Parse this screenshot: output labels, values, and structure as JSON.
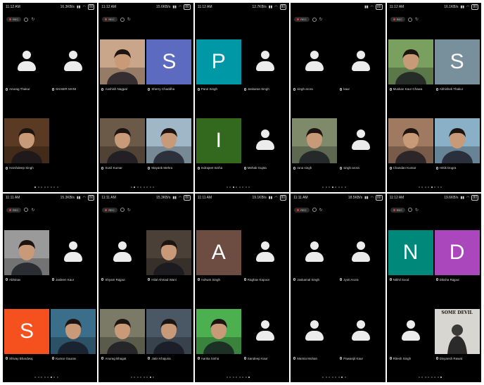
{
  "panels": [
    {
      "status": {
        "time": "11:12 AM",
        "speed": "16.3KB/s",
        "battery": "80"
      },
      "show_rec": true,
      "tiles": [
        {
          "name": "Anurag Thakur",
          "type": "avatar"
        },
        {
          "name": "SHABIR MANI",
          "type": "avatar"
        },
        {
          "name": "Harshdeep Singh",
          "type": "photo",
          "tone": "#5a3a22"
        },
        {
          "name": "",
          "type": "empty"
        }
      ],
      "page_dots": 8,
      "active_dot": 0
    },
    {
      "status": {
        "time": "11:12 AM",
        "speed": "15.6KB/s",
        "battery": "80"
      },
      "show_rec": true,
      "tiles": [
        {
          "name": "Aashish Nagpal",
          "type": "photo",
          "tone": "#c9a58a"
        },
        {
          "name": "Sherry Chaddha",
          "type": "letter",
          "letter": "S",
          "bg": "#5c6bc0"
        },
        {
          "name": "Sunil Kumar",
          "type": "photo",
          "tone": "#6b5a48"
        },
        {
          "name": "Mayank Mehra",
          "type": "photo",
          "tone": "#9fb7c6"
        }
      ],
      "page_dots": 8,
      "active_dot": 1
    },
    {
      "status": {
        "time": "11:12 AM",
        "speed": "12.7KB/s",
        "battery": "80"
      },
      "show_rec": false,
      "tiles": [
        {
          "name": "Parul Singh",
          "type": "letter",
          "letter": "P",
          "bg": "#0097a7"
        },
        {
          "name": "Jaskaran Singh",
          "type": "avatar"
        },
        {
          "name": "Indrajeet Sinha",
          "type": "letter",
          "letter": "I",
          "bg": "#33691e"
        },
        {
          "name": "Mehak Gupta",
          "type": "avatar"
        }
      ],
      "page_dots": 8,
      "active_dot": 2
    },
    {
      "status": {
        "time": "",
        "speed": "",
        "battery": "80"
      },
      "show_rec": true,
      "tiles": [
        {
          "name": "singh arora",
          "type": "avatar"
        },
        {
          "name": "kaur",
          "type": "avatar"
        },
        {
          "name": "rana singh",
          "type": "photo",
          "tone": "#7e8a6a"
        },
        {
          "name": "singh arora",
          "type": "avatar"
        }
      ],
      "page_dots": 8,
      "active_dot": 3
    },
    {
      "status": {
        "time": "11:12 AM",
        "speed": "16.1KB/s",
        "battery": "80"
      },
      "show_rec": true,
      "tiles": [
        {
          "name": "Muskan Kaur Chawa",
          "type": "photo",
          "tone": "#7aa060"
        },
        {
          "name": "Abhishek Thakur",
          "type": "letter",
          "letter": "S",
          "bg": "#78909c"
        },
        {
          "name": "Chandan Kumar",
          "type": "photo",
          "tone": "#a07a60"
        },
        {
          "name": "Hritik Dogra",
          "type": "photo",
          "tone": "#8ab0c8"
        }
      ],
      "page_dots": 8,
      "active_dot": 4
    },
    {
      "status": {
        "time": "11:11 AM",
        "speed": "15.3KB/s",
        "battery": "80"
      },
      "show_rec": true,
      "tiles": [
        {
          "name": "Abhinav",
          "type": "photo",
          "tone": "#9a9a9a"
        },
        {
          "name": "Jasleen Kaur",
          "type": "avatar"
        },
        {
          "name": "Shivay Bhardwaj",
          "type": "letter",
          "letter": "S",
          "bg": "#f4511e"
        },
        {
          "name": "Kumar Gaurav",
          "type": "photo",
          "tone": "#3b6e8a"
        }
      ],
      "page_dots": 8,
      "active_dot": 5
    },
    {
      "status": {
        "time": "11:11 AM",
        "speed": "15.3KB/s",
        "battery": "80"
      },
      "show_rec": true,
      "tiles": [
        {
          "name": "Shyam Rajput",
          "type": "avatar"
        },
        {
          "name": "Hilal Ahmad Wani",
          "type": "photo",
          "tone": "#4a4038"
        },
        {
          "name": "Anurag Bhagat",
          "type": "photo",
          "tone": "#7a7a66"
        },
        {
          "name": "Jatin Khajuria",
          "type": "photo",
          "tone": "#4a5866"
        }
      ],
      "page_dots": 8,
      "active_dot": 6
    },
    {
      "status": {
        "time": "11:11 AM",
        "speed": "19.1KB/s",
        "battery": "80"
      },
      "show_rec": false,
      "tiles": [
        {
          "name": "Ashwin Singh",
          "type": "letter",
          "letter": "A",
          "bg": "#6d4c41"
        },
        {
          "name": "Raghav Kapoor",
          "type": "avatar"
        },
        {
          "name": "Aarika Sinha",
          "type": "photo",
          "tone": "#4caf50"
        },
        {
          "name": "Sandeep Kaur",
          "type": "avatar"
        }
      ],
      "page_dots": 8,
      "active_dot": 7
    },
    {
      "status": {
        "time": "11:11 AM",
        "speed": "18.5KB/s",
        "battery": "80"
      },
      "show_rec": true,
      "tiles": [
        {
          "name": "Jaskamal Singh",
          "type": "avatar"
        },
        {
          "name": "Jyoti Arora",
          "type": "avatar"
        },
        {
          "name": "Mamta Mohan",
          "type": "avatar"
        },
        {
          "name": "Pawanjit Kaur",
          "type": "avatar"
        }
      ],
      "page_dots": 8,
      "active_dot": 6
    },
    {
      "status": {
        "time": "11:12 AM",
        "speed": "19.6KB/s",
        "battery": "80"
      },
      "show_rec": true,
      "tiles": [
        {
          "name": "Nikhil Sood",
          "type": "letter",
          "letter": "N",
          "bg": "#00897b"
        },
        {
          "name": "Diksha Rajput",
          "type": "letter",
          "letter": "D",
          "bg": "#ab47bc"
        },
        {
          "name": "Ritesh Singh",
          "type": "avatar"
        },
        {
          "name": "Divyansh Rawat",
          "type": "album",
          "title": "SOME DEVIL"
        }
      ],
      "page_dots": 8,
      "active_dot": 7
    }
  ]
}
